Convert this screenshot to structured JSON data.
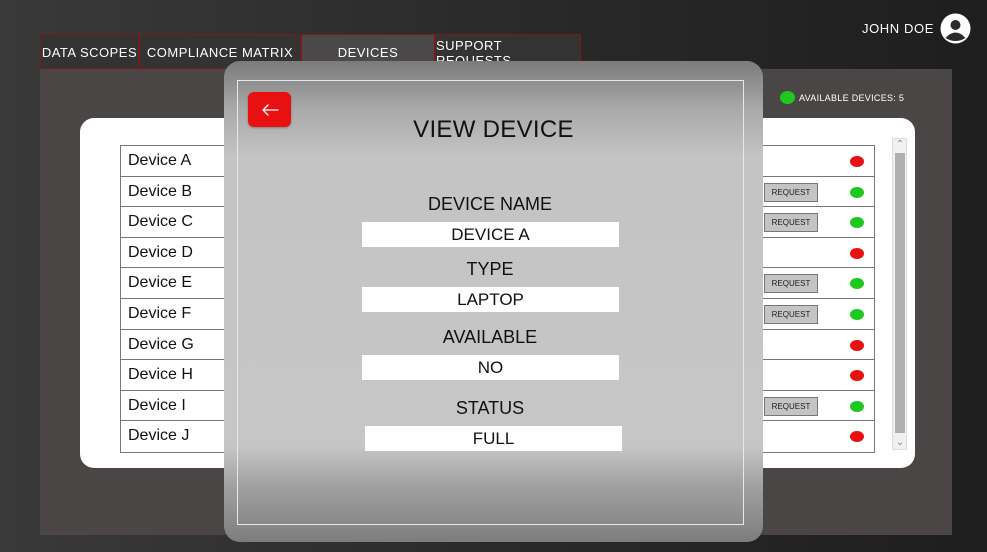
{
  "nav": {
    "tabs": [
      {
        "label": "DATA SCOPES"
      },
      {
        "label": "COMPLIANCE MATRIX"
      },
      {
        "label": "DEVICES"
      },
      {
        "label": "SUPPORT REQUESTS"
      }
    ],
    "active_tab": "DEVICES"
  },
  "user": {
    "name": "JOHN DOE",
    "icon": "user-avatar-icon"
  },
  "availability": {
    "label": "AVAILABLE DEVICES: 5",
    "color": "#1ec81e"
  },
  "devices": [
    {
      "name": "Device A",
      "request_label": "",
      "status_color": "#e81010"
    },
    {
      "name": "Device B",
      "request_label": "REQUEST",
      "status_color": "#1ec81e"
    },
    {
      "name": "Device C",
      "request_label": "REQUEST",
      "status_color": "#1ec81e"
    },
    {
      "name": "Device D",
      "request_label": "",
      "status_color": "#e81010"
    },
    {
      "name": "Device E",
      "request_label": "REQUEST",
      "status_color": "#1ec81e"
    },
    {
      "name": "Device F",
      "request_label": "REQUEST",
      "status_color": "#1ec81e"
    },
    {
      "name": "Device G",
      "request_label": "",
      "status_color": "#e81010"
    },
    {
      "name": "Device H",
      "request_label": "",
      "status_color": "#e81010"
    },
    {
      "name": "Device I",
      "request_label": "REQUEST",
      "status_color": "#1ec81e"
    },
    {
      "name": "Device J",
      "request_label": "",
      "status_color": "#e81010"
    }
  ],
  "modal": {
    "title": "VIEW DEVICE",
    "back_icon": "arrow-left-icon",
    "fields": {
      "device_name": {
        "label": "DEVICE NAME",
        "value": "DEVICE A"
      },
      "type": {
        "label": "TYPE",
        "value": "LAPTOP"
      },
      "available": {
        "label": "AVAILABLE",
        "value": "NO"
      },
      "status": {
        "label": "STATUS",
        "value": "FULL"
      }
    }
  },
  "colors": {
    "accent_red": "#e81010",
    "available_green": "#1ec81e"
  }
}
